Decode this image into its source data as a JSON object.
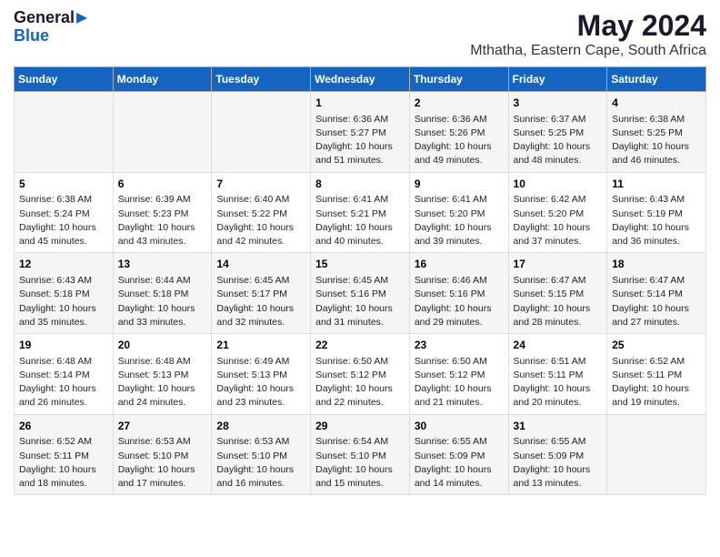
{
  "header": {
    "logo_general": "General",
    "logo_blue": "Blue",
    "title": "May 2024",
    "subtitle": "Mthatha, Eastern Cape, South Africa"
  },
  "days_of_week": [
    "Sunday",
    "Monday",
    "Tuesday",
    "Wednesday",
    "Thursday",
    "Friday",
    "Saturday"
  ],
  "weeks": [
    [
      {
        "day": "",
        "info": ""
      },
      {
        "day": "",
        "info": ""
      },
      {
        "day": "",
        "info": ""
      },
      {
        "day": "1",
        "info": "Sunrise: 6:36 AM\nSunset: 5:27 PM\nDaylight: 10 hours\nand 51 minutes."
      },
      {
        "day": "2",
        "info": "Sunrise: 6:36 AM\nSunset: 5:26 PM\nDaylight: 10 hours\nand 49 minutes."
      },
      {
        "day": "3",
        "info": "Sunrise: 6:37 AM\nSunset: 5:25 PM\nDaylight: 10 hours\nand 48 minutes."
      },
      {
        "day": "4",
        "info": "Sunrise: 6:38 AM\nSunset: 5:25 PM\nDaylight: 10 hours\nand 46 minutes."
      }
    ],
    [
      {
        "day": "5",
        "info": "Sunrise: 6:38 AM\nSunset: 5:24 PM\nDaylight: 10 hours\nand 45 minutes."
      },
      {
        "day": "6",
        "info": "Sunrise: 6:39 AM\nSunset: 5:23 PM\nDaylight: 10 hours\nand 43 minutes."
      },
      {
        "day": "7",
        "info": "Sunrise: 6:40 AM\nSunset: 5:22 PM\nDaylight: 10 hours\nand 42 minutes."
      },
      {
        "day": "8",
        "info": "Sunrise: 6:41 AM\nSunset: 5:21 PM\nDaylight: 10 hours\nand 40 minutes."
      },
      {
        "day": "9",
        "info": "Sunrise: 6:41 AM\nSunset: 5:20 PM\nDaylight: 10 hours\nand 39 minutes."
      },
      {
        "day": "10",
        "info": "Sunrise: 6:42 AM\nSunset: 5:20 PM\nDaylight: 10 hours\nand 37 minutes."
      },
      {
        "day": "11",
        "info": "Sunrise: 6:43 AM\nSunset: 5:19 PM\nDaylight: 10 hours\nand 36 minutes."
      }
    ],
    [
      {
        "day": "12",
        "info": "Sunrise: 6:43 AM\nSunset: 5:18 PM\nDaylight: 10 hours\nand 35 minutes."
      },
      {
        "day": "13",
        "info": "Sunrise: 6:44 AM\nSunset: 5:18 PM\nDaylight: 10 hours\nand 33 minutes."
      },
      {
        "day": "14",
        "info": "Sunrise: 6:45 AM\nSunset: 5:17 PM\nDaylight: 10 hours\nand 32 minutes."
      },
      {
        "day": "15",
        "info": "Sunrise: 6:45 AM\nSunset: 5:16 PM\nDaylight: 10 hours\nand 31 minutes."
      },
      {
        "day": "16",
        "info": "Sunrise: 6:46 AM\nSunset: 5:16 PM\nDaylight: 10 hours\nand 29 minutes."
      },
      {
        "day": "17",
        "info": "Sunrise: 6:47 AM\nSunset: 5:15 PM\nDaylight: 10 hours\nand 28 minutes."
      },
      {
        "day": "18",
        "info": "Sunrise: 6:47 AM\nSunset: 5:14 PM\nDaylight: 10 hours\nand 27 minutes."
      }
    ],
    [
      {
        "day": "19",
        "info": "Sunrise: 6:48 AM\nSunset: 5:14 PM\nDaylight: 10 hours\nand 26 minutes."
      },
      {
        "day": "20",
        "info": "Sunrise: 6:48 AM\nSunset: 5:13 PM\nDaylight: 10 hours\nand 24 minutes."
      },
      {
        "day": "21",
        "info": "Sunrise: 6:49 AM\nSunset: 5:13 PM\nDaylight: 10 hours\nand 23 minutes."
      },
      {
        "day": "22",
        "info": "Sunrise: 6:50 AM\nSunset: 5:12 PM\nDaylight: 10 hours\nand 22 minutes."
      },
      {
        "day": "23",
        "info": "Sunrise: 6:50 AM\nSunset: 5:12 PM\nDaylight: 10 hours\nand 21 minutes."
      },
      {
        "day": "24",
        "info": "Sunrise: 6:51 AM\nSunset: 5:11 PM\nDaylight: 10 hours\nand 20 minutes."
      },
      {
        "day": "25",
        "info": "Sunrise: 6:52 AM\nSunset: 5:11 PM\nDaylight: 10 hours\nand 19 minutes."
      }
    ],
    [
      {
        "day": "26",
        "info": "Sunrise: 6:52 AM\nSunset: 5:11 PM\nDaylight: 10 hours\nand 18 minutes."
      },
      {
        "day": "27",
        "info": "Sunrise: 6:53 AM\nSunset: 5:10 PM\nDaylight: 10 hours\nand 17 minutes."
      },
      {
        "day": "28",
        "info": "Sunrise: 6:53 AM\nSunset: 5:10 PM\nDaylight: 10 hours\nand 16 minutes."
      },
      {
        "day": "29",
        "info": "Sunrise: 6:54 AM\nSunset: 5:10 PM\nDaylight: 10 hours\nand 15 minutes."
      },
      {
        "day": "30",
        "info": "Sunrise: 6:55 AM\nSunset: 5:09 PM\nDaylight: 10 hours\nand 14 minutes."
      },
      {
        "day": "31",
        "info": "Sunrise: 6:55 AM\nSunset: 5:09 PM\nDaylight: 10 hours\nand 13 minutes."
      },
      {
        "day": "",
        "info": ""
      }
    ]
  ]
}
